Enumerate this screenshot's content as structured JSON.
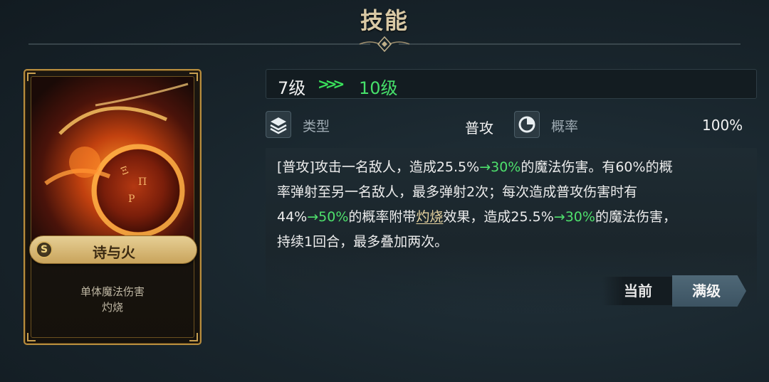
{
  "header": {
    "title": "技能"
  },
  "card": {
    "rank": "S",
    "name": "诗与火",
    "desc_line1": "单体魔法伤害",
    "desc_line2": "灼烧"
  },
  "level": {
    "current": "7级",
    "arrow": ">>>",
    "next": "10级"
  },
  "stats": {
    "type": {
      "icon": "layers-icon",
      "label": "类型",
      "value": "普攻"
    },
    "chance": {
      "icon": "pie-chart-icon",
      "label": "概率",
      "value": "100%"
    }
  },
  "description": {
    "line1_a": "[普攻]攻击一名敌人，造成25.5%",
    "line1_b": "→30%",
    "line1_c": "的魔法伤害。有60%的概",
    "line2": "率弹射至另一名敌人，最多弹射2次；每次造成普攻伤害时有",
    "line3_a": "44%",
    "line3_b": "→50%",
    "line3_c": "的概率附带",
    "line3_d": "灼烧",
    "line3_e": "效果，造成25.5%",
    "line3_f": "→30%",
    "line3_g": "的魔法伤害，",
    "line4": "持续1回合，最多叠加两次。"
  },
  "buttons": {
    "current": "当前",
    "max": "满级"
  },
  "colors": {
    "highlight": "#4ee06c",
    "gold": "#c9a45c"
  }
}
